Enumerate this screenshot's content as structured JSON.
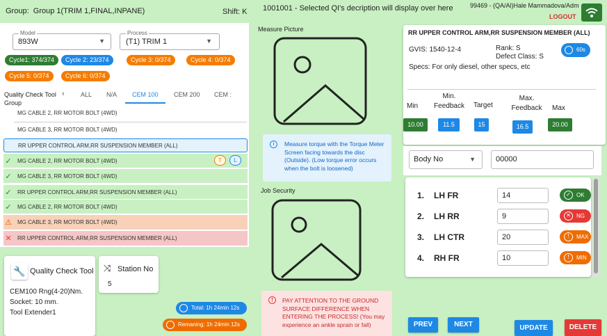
{
  "header": {
    "group_label": "Group:",
    "group_value": "Group 1(TRIM 1,FINAL,INPANE)",
    "shift": "Shift: K",
    "qi_message": "1001001 - Selected QI's decription will display over here",
    "user": "99469 - (QA/Al)Hale Mammadova/Adm",
    "logout": "LOGOUT"
  },
  "selectors": {
    "model_label": "Model",
    "model_value": "893W",
    "process_label": "Process",
    "process_value": "(T1) TRIM 1"
  },
  "cycles": [
    "Cycle1: 374/374",
    "Cycle 2: 23/374",
    "Cycle 3: 0/374",
    "Cycle 4: 0/374",
    "Cycle 5: 0/374",
    "Cycle 6: 0/374"
  ],
  "tabs": {
    "group_label_1": "Quality Check Tool",
    "group_label_2": "Group",
    "items": [
      "ALL",
      "N/A",
      "CEM 100",
      "CEM 200",
      "CEM :"
    ]
  },
  "items": [
    "MG CABLE 2, RR MOTOR BOLT (4WD)",
    "MG CABLE 3, RR MOTOR BOLT (4WD)",
    "RR UPPER CONTROL ARM,RR SUSPENSION  MEMBER (ALL)",
    "MG CABLE 2, RR MOTOR BOLT (4WD)",
    "MG CABLE 3, RR MOTOR BOLT (4WD)",
    "RR UPPER CONTROL ARM,RR SUSPENSION  MEMBER (ALL)",
    "MG CABLE 2, RR MOTOR BOLT (4WD)",
    "MG CABLE 3, RR MOTOR BOLT (4WD)",
    "RR UPPER CONTROL ARM,RR SUSPENSION  MEMBER (ALL)"
  ],
  "badges": {
    "t": "T",
    "l": "L"
  },
  "tool": {
    "title": "Quality Check Tool",
    "line1": "CEM100 Rng(4-20)Nm.",
    "line2": "Socket: 10 mm.",
    "line3": "Tool Extender1"
  },
  "station": {
    "title": "Station No",
    "value": "5"
  },
  "timers": {
    "total": "Total: 1h 24min 12s",
    "remaining": "Remaning: 1h 24min 12s"
  },
  "middle": {
    "measure_title": "Measure Picture",
    "measure_info": "Measure torque with the Torque Meter Screen facing towards the disc (Outside). (Low torque error occurs when the bolt is loosened)",
    "job_title": "Job Security",
    "warning": "PAY ATTENTION TO THE GROUND SURFACE DIFFERENCE WHEN ENTERING THE PROCESS! (You may experience an ankle sprain or fall)"
  },
  "detail": {
    "title": "RR UPPER CONTROL ARM,RR SUSPENSION  MEMBER (ALL)",
    "gvis": "GVIS: 1540-12-4",
    "rank": "Rank: S",
    "defect": "Defect Class: S",
    "timer": "60s",
    "specs": "Specs: For only diesel, other specs, etc",
    "col_min": "Min",
    "col_minfb_1": "Min.",
    "col_minfb_2": "Feedback",
    "col_target": "Target",
    "col_maxfb_1": "Max.",
    "col_maxfb_2": "Feedback",
    "col_max": "Max",
    "v_min": "10.00",
    "v_minfb": "11.5",
    "v_target": "15",
    "v_maxfb": "16.5",
    "v_max": "20.00"
  },
  "body": {
    "label": "Body No",
    "value": "00000"
  },
  "measurements": [
    {
      "no": "1.",
      "name": "LH FR",
      "value": "14",
      "status": "OK",
      "color": "#2e7d32"
    },
    {
      "no": "2.",
      "name": "LH RR",
      "value": "9",
      "status": "NG",
      "color": "#e53935"
    },
    {
      "no": "3.",
      "name": "LH CTR",
      "value": "20",
      "status": "MAX",
      "color": "#ef6c00"
    },
    {
      "no": "4.",
      "name": "RH FR",
      "value": "10",
      "status": "MIN",
      "color": "#ef6c00"
    }
  ],
  "actions": {
    "prev": "PREV",
    "next": "NEXT",
    "update": "UPDATE",
    "delete": "DELETE"
  }
}
